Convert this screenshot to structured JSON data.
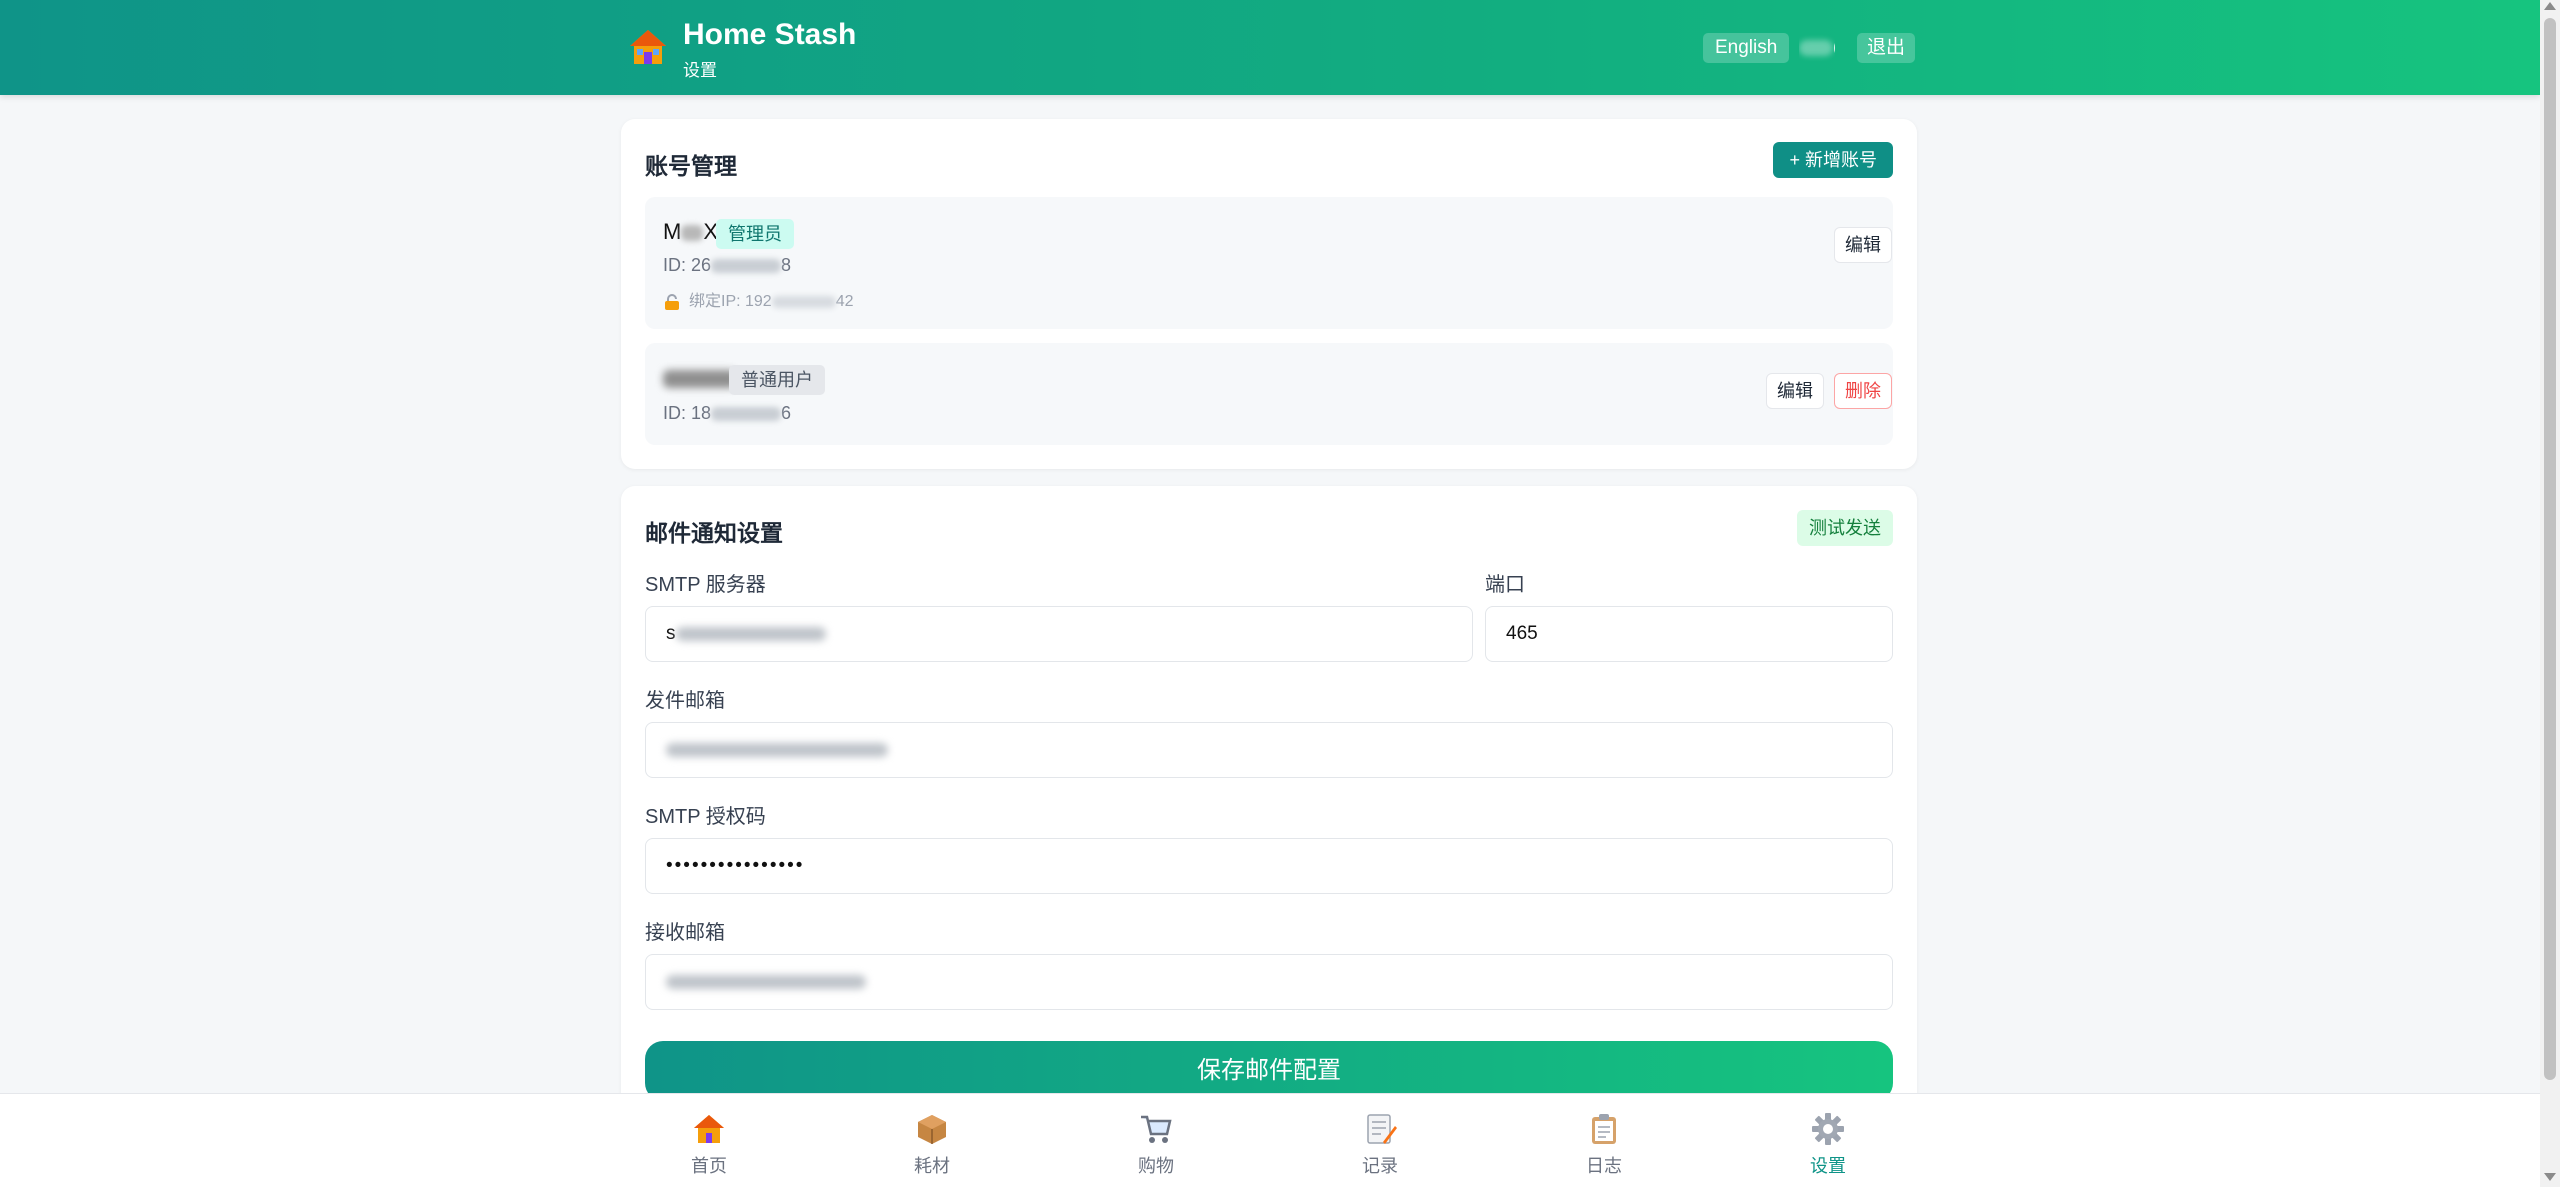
{
  "header": {
    "title": "Home Stash",
    "subtitle": "设置",
    "language_button": "English",
    "user_name_visible": "(",
    "logout_button": "退出"
  },
  "accounts": {
    "title": "账号管理",
    "add_button": "+ 新增账号",
    "items": [
      {
        "name_prefix": "M",
        "name_suffix": "X",
        "role": "管理员",
        "id_prefix": "ID: 26",
        "id_suffix": "8",
        "ip_label": "绑定IP: 192",
        "ip_suffix": "42",
        "edit_label": "编辑"
      },
      {
        "role": "普通用户",
        "id_prefix": "ID: 18",
        "id_suffix": "6",
        "edit_label": "编辑",
        "delete_label": "删除"
      }
    ]
  },
  "email": {
    "title": "邮件通知设置",
    "test_button": "测试发送",
    "smtp_server_label": "SMTP 服务器",
    "smtp_server_value_prefix": "s",
    "port_label": "端口",
    "port_value": "465",
    "sender_label": "发件邮箱",
    "auth_label": "SMTP 授权码",
    "auth_value": "••••••••••••••••",
    "receiver_label": "接收邮箱",
    "save_button": "保存邮件配置"
  },
  "nav": {
    "items": [
      {
        "label": "首页",
        "icon": "home-icon"
      },
      {
        "label": "耗材",
        "icon": "package-icon"
      },
      {
        "label": "购物",
        "icon": "cart-icon"
      },
      {
        "label": "记录",
        "icon": "memo-icon"
      },
      {
        "label": "日志",
        "icon": "clipboard-icon"
      },
      {
        "label": "设置",
        "icon": "gear-icon",
        "active": true
      }
    ]
  },
  "colors": {
    "brand": "#0f9488",
    "brand_end": "#16c47f",
    "danger": "#ef4444"
  }
}
